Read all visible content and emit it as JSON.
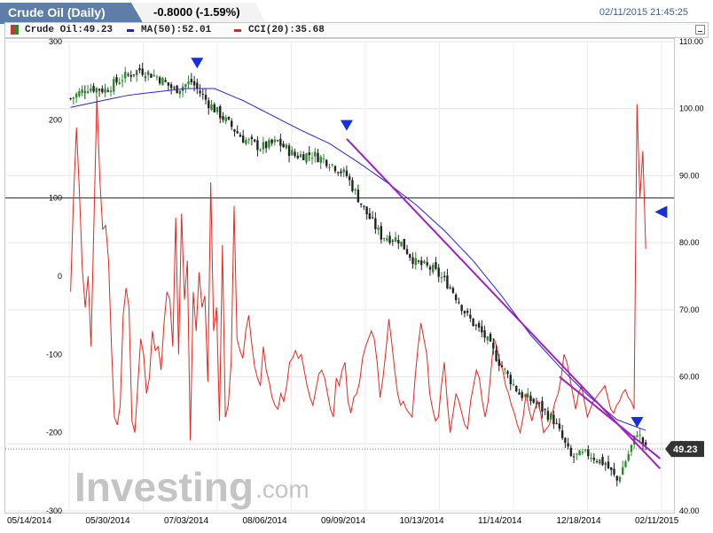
{
  "header": {
    "title": "Crude Oil (Daily)",
    "change": "-0.8000 (-1.59%)",
    "timestamp": "02/11/2015 21:45:25"
  },
  "legend": {
    "items": [
      {
        "label": "Crude Oil:49.23",
        "color": "#cc3333"
      },
      {
        "label": "MA(50):52.01",
        "color": "#1f1fcc"
      },
      {
        "label": "CCI(20):35.68",
        "color": "#dd2222"
      }
    ]
  },
  "watermark": {
    "brand": "Investing",
    "domain": ".com"
  },
  "colors": {
    "up": "#2c8a2c",
    "down": "#222222",
    "ma": "#2424cc",
    "cci": "#e8261e",
    "trend": "#a020c0",
    "marker": "#1630d8",
    "hline": "#1a1a6e",
    "price_tag": "#333333"
  },
  "chart_data": {
    "type": "candlestick",
    "price_axis": {
      "side": "right",
      "min": 40,
      "max": 110,
      "ticks": [
        40,
        50,
        60,
        70,
        80,
        90,
        100,
        110
      ],
      "tick_labels": [
        "40.00",
        "50.00",
        "60.00",
        "70.00",
        "80.00",
        "90.00",
        "100.00",
        "110.00"
      ]
    },
    "cci_axis": {
      "side": "left",
      "min": -300,
      "max": 300,
      "ticks": [
        -300,
        -200,
        -100,
        0,
        100,
        200,
        300
      ]
    },
    "x_labels": [
      "05/14/2014",
      "05/30/2014",
      "07/03/2014",
      "08/06/2014",
      "09/09/2014",
      "10/13/2014",
      "11/14/2014",
      "12/18/2014",
      "02/11/2015"
    ],
    "last_price": "49.23",
    "last_price_value": 49.23,
    "cci_reference_line": 100,
    "price_anchors": [
      {
        "i": 0,
        "p": 101.5
      },
      {
        "i": 6,
        "p": 103.2
      },
      {
        "i": 12,
        "p": 102.8
      },
      {
        "i": 18,
        "p": 104.6
      },
      {
        "i": 24,
        "p": 105.8
      },
      {
        "i": 30,
        "p": 104.8
      },
      {
        "i": 36,
        "p": 102.8
      },
      {
        "i": 42,
        "p": 104.0
      },
      {
        "i": 48,
        "p": 100.8
      },
      {
        "i": 54,
        "p": 98.2
      },
      {
        "i": 60,
        "p": 95.5
      },
      {
        "i": 66,
        "p": 94.2
      },
      {
        "i": 72,
        "p": 95.0
      },
      {
        "i": 78,
        "p": 93.0
      },
      {
        "i": 84,
        "p": 93.2
      },
      {
        "i": 90,
        "p": 92.0
      },
      {
        "i": 96,
        "p": 90.0
      },
      {
        "i": 102,
        "p": 85.0
      },
      {
        "i": 108,
        "p": 81.0
      },
      {
        "i": 114,
        "p": 80.5
      },
      {
        "i": 120,
        "p": 77.0
      },
      {
        "i": 126,
        "p": 76.0
      },
      {
        "i": 132,
        "p": 73.5
      },
      {
        "i": 138,
        "p": 69.0
      },
      {
        "i": 144,
        "p": 66.0
      },
      {
        "i": 150,
        "p": 61.5
      },
      {
        "i": 156,
        "p": 57.5
      },
      {
        "i": 162,
        "p": 56.0
      },
      {
        "i": 168,
        "p": 53.5
      },
      {
        "i": 174,
        "p": 48.0
      },
      {
        "i": 180,
        "p": 48.5
      },
      {
        "i": 186,
        "p": 47.0
      },
      {
        "i": 190,
        "p": 44.5
      },
      {
        "i": 194,
        "p": 48.5
      },
      {
        "i": 197,
        "p": 51.8
      },
      {
        "i": 200,
        "p": 49.23
      }
    ],
    "ma_anchors": [
      {
        "i": 0,
        "p": 100.2
      },
      {
        "i": 20,
        "p": 102.0
      },
      {
        "i": 40,
        "p": 103.0
      },
      {
        "i": 50,
        "p": 103.0
      },
      {
        "i": 60,
        "p": 101.2
      },
      {
        "i": 70,
        "p": 99.0
      },
      {
        "i": 80,
        "p": 96.8
      },
      {
        "i": 90,
        "p": 94.8
      },
      {
        "i": 100,
        "p": 92.0
      },
      {
        "i": 110,
        "p": 89.0
      },
      {
        "i": 120,
        "p": 85.7
      },
      {
        "i": 130,
        "p": 81.8
      },
      {
        "i": 140,
        "p": 77.3
      },
      {
        "i": 150,
        "p": 72.0
      },
      {
        "i": 160,
        "p": 66.2
      },
      {
        "i": 170,
        "p": 61.5
      },
      {
        "i": 180,
        "p": 57.2
      },
      {
        "i": 190,
        "p": 53.6
      },
      {
        "i": 200,
        "p": 52.01
      }
    ],
    "cci": [
      -20,
      100,
      190,
      110,
      10,
      -40,
      0,
      -90,
      70,
      230,
      125,
      60,
      65,
      20,
      -90,
      -180,
      -190,
      -165,
      -50,
      -15,
      -40,
      -185,
      -200,
      -140,
      -80,
      -100,
      -150,
      -130,
      -70,
      -95,
      -90,
      -120,
      -60,
      -20,
      -30,
      -90,
      75,
      -100,
      80,
      -30,
      20,
      -210,
      -20,
      -70,
      5,
      -40,
      -25,
      -135,
      120,
      -70,
      -40,
      -185,
      40,
      -180,
      -165,
      -110,
      90,
      -80,
      -95,
      -105,
      -70,
      -50,
      -85,
      -115,
      -130,
      -140,
      -90,
      -120,
      -135,
      -155,
      -165,
      -170,
      -150,
      -160,
      -140,
      -110,
      -105,
      -95,
      -105,
      -100,
      -120,
      -140,
      -155,
      -165,
      -145,
      -125,
      -120,
      -130,
      -150,
      -170,
      -180,
      -130,
      -140,
      -120,
      -110,
      -160,
      -175,
      -155,
      -150,
      -135,
      -105,
      -90,
      -80,
      -70,
      -80,
      -110,
      -155,
      -130,
      -95,
      -55,
      -85,
      -120,
      -150,
      -165,
      -160,
      -170,
      -175,
      -180,
      -130,
      -90,
      -60,
      -80,
      -100,
      -150,
      -170,
      -185,
      -180,
      -140,
      -110,
      -160,
      -200,
      -175,
      -150,
      -160,
      -175,
      -190,
      -195,
      -160,
      -140,
      -120,
      -130,
      -160,
      -180,
      -160,
      -120,
      -80,
      -90,
      -110,
      -120,
      -140,
      -150,
      -165,
      -175,
      -190,
      -200,
      -180,
      -150,
      -170,
      -185,
      -170,
      -160,
      -175,
      -200,
      -195,
      -190,
      -175,
      -160,
      -150,
      -130,
      -100,
      -110,
      -130,
      -150,
      -170,
      -150,
      -140,
      -160,
      -180,
      -170,
      -160,
      -155,
      -150,
      -145,
      -140,
      -155,
      -170,
      -175,
      -165,
      -160,
      -150,
      -145,
      -155,
      -160,
      -170,
      220,
      100,
      160,
      35
    ],
    "trendlines": [
      {
        "from": {
          "i": 96,
          "p": 95.5
        },
        "to": {
          "i": 205,
          "p": 46.3
        }
      },
      {
        "from": {
          "i": 170,
          "p": 60.0
        },
        "to": {
          "i": 205,
          "p": 47.8
        }
      }
    ],
    "markers_down": [
      {
        "i": 44,
        "p": 106.8
      },
      {
        "i": 96,
        "p": 97.5
      },
      {
        "i": 197,
        "p": 53.2
      }
    ],
    "marker_left": {
      "i": 201,
      "p": 84.6
    }
  }
}
